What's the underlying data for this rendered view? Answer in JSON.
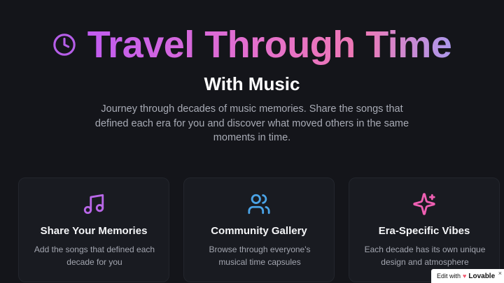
{
  "hero": {
    "title": "Travel Through Time",
    "subtitle": "With Music",
    "description": "Journey through decades of music memories. Share the songs that defined each era for you and discover what moved others in the same moments in time.",
    "icon": "clock-icon"
  },
  "features": [
    {
      "icon": "music-note-icon",
      "title": "Share Your Memories",
      "description": "Add the songs that defined each decade for you",
      "color": "#b967e8"
    },
    {
      "icon": "users-icon",
      "title": "Community Gallery",
      "description": "Browse through everyone's musical time capsules",
      "color": "#4aa3e6"
    },
    {
      "icon": "sparkles-icon",
      "title": "Era-Specific Vibes",
      "description": "Each decade has its own unique design and atmosphere",
      "color": "#ee5fb2"
    }
  ],
  "badge": {
    "prefix": "Edit with",
    "brand": "Lovable",
    "close": "×"
  },
  "colors": {
    "background": "#14151a",
    "card": "#191b21",
    "gradient_start": "#c15cf0",
    "gradient_end": "#ad98ec"
  }
}
